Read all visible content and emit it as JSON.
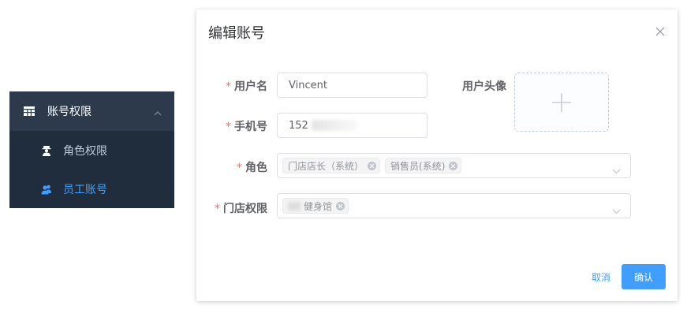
{
  "sidebar": {
    "group_label": "账号权限",
    "items": [
      {
        "label": "角色权限",
        "icon": "user-secret-icon",
        "active": false
      },
      {
        "label": "员工账号",
        "icon": "users-icon",
        "active": true
      }
    ]
  },
  "dialog": {
    "title": "编辑账号",
    "fields": {
      "username": {
        "label": "用户名",
        "value": "Vincent"
      },
      "avatar": {
        "label": "用户头像"
      },
      "phone": {
        "label": "手机号",
        "value": "152"
      },
      "role": {
        "label": "角色",
        "tags": [
          "门店店长（系统）",
          "销售员(系统)"
        ]
      },
      "store": {
        "label": "门店权限",
        "tags": [
          "健身馆"
        ]
      }
    },
    "buttons": {
      "cancel": "取消",
      "confirm": "确认"
    }
  },
  "colors": {
    "accent": "#409eff",
    "required": "#f56c6c",
    "sidebar_bg": "#2d3a4b",
    "submenu_bg": "#1f2d3d"
  }
}
